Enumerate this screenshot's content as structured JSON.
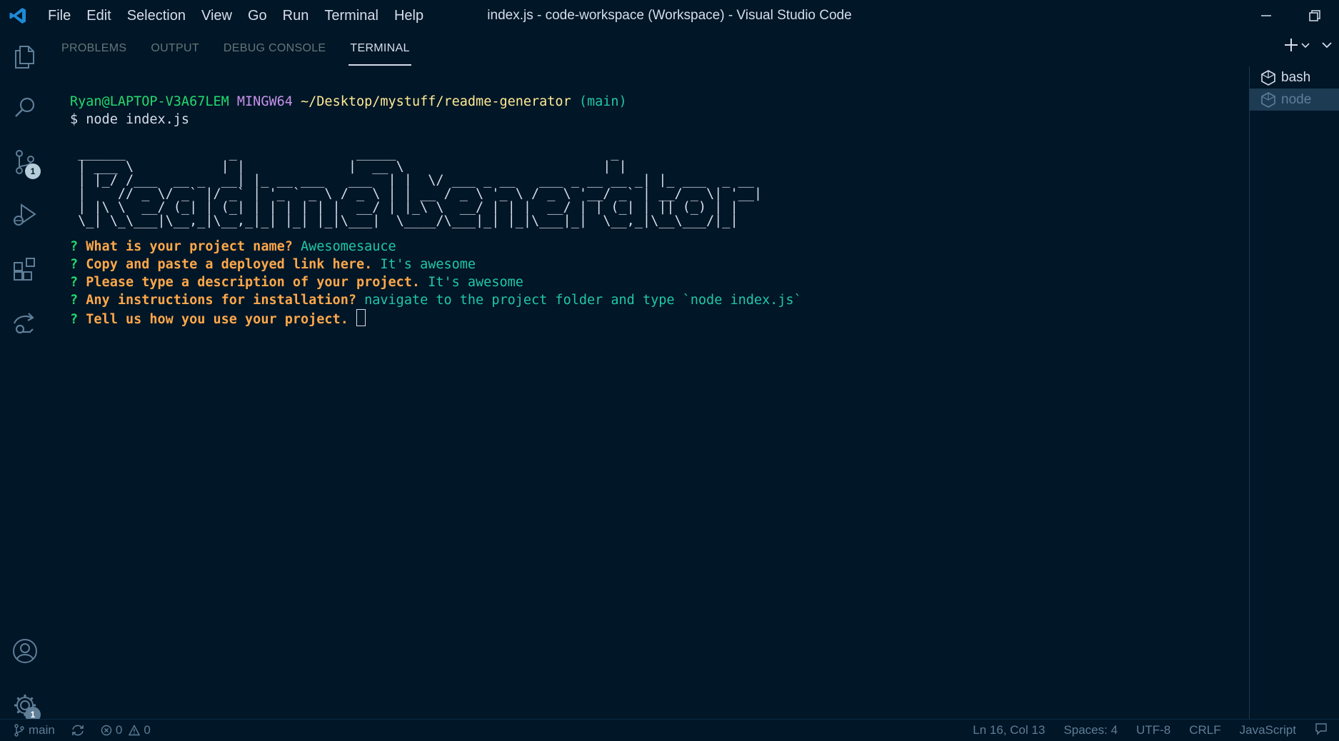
{
  "titlebar": {
    "menus": [
      "File",
      "Edit",
      "Selection",
      "View",
      "Go",
      "Run",
      "Terminal",
      "Help"
    ],
    "title": "index.js - code-workspace (Workspace) - Visual Studio Code"
  },
  "activitybar": {
    "scm_badge": "1",
    "manage_badge": "1"
  },
  "panel": {
    "tabs": [
      "PROBLEMS",
      "OUTPUT",
      "DEBUG CONSOLE",
      "TERMINAL"
    ],
    "active_tab": "TERMINAL"
  },
  "terminal": {
    "prompt_user": "Ryan@LAPTOP-V3A67LEM",
    "prompt_env": "MINGW64",
    "prompt_path": "~/Desktop/mystuff/readme-generator",
    "prompt_branch": "(main)",
    "command": "$ node index.js",
    "ascii_art": [
      " ______             _               _____                           _             ",
      " | ___ \\           | |             |  __ \\                         | |            ",
      " | |_/ /___  __ _  __| |_ __ ___   ___  | |  \\/ ___ _ __   ___ _ __ __ _| |_ ___  _ __ ",
      " |    // _ \\/ _` |/ _` | '_ ` _ \\ / _ \\ | | __ / _ \\ '_ \\ / _ \\ '__/ _` | __/ _ \\| '__|",
      " | |\\ \\  __/ (_| | (_| | | | | | |  __/ | |_\\ \\  __/ | | |  __/ | | (_| | || (_) | |   ",
      " \\_| \\_\\___|\\__,_|\\__,_|_| |_| |_|\\___|  \\____/\\___|_| |_|\\___|_|  \\__,_|\\__\\___/|_|   "
    ],
    "questions": [
      {
        "mark": "?",
        "q": "What is your project name?",
        "a": "Awesomesauce"
      },
      {
        "mark": "?",
        "q": "Copy and paste a deployed link here.",
        "a": "It's awesome"
      },
      {
        "mark": "?",
        "q": "Please type a description of your project.",
        "a": "It's awesome"
      },
      {
        "mark": "?",
        "q": "Any instructions for installation?",
        "a": "navigate to the project folder and type `node index.js`"
      },
      {
        "mark": "?",
        "q": "Tell us how you use your project.",
        "a": ""
      }
    ]
  },
  "terminal_list": [
    "bash",
    "node"
  ],
  "statusbar": {
    "branch": "main",
    "errors": "0",
    "warnings": "0",
    "position": "Ln 16, Col 13",
    "spaces": "Spaces: 4",
    "encoding": "UTF-8",
    "eol": "CRLF",
    "language": "JavaScript"
  },
  "colors": {
    "background": "#011627",
    "prompt_green": "#22da6e",
    "prompt_purple": "#c792ea",
    "prompt_yellow": "#ffeb95",
    "question_orange": "#ffa84a",
    "answer_teal": "#21c7a8"
  }
}
